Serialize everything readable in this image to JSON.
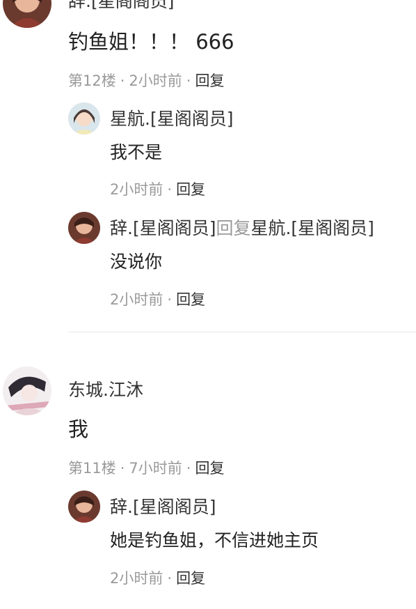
{
  "comments": [
    {
      "author": "辞.[星阁阁员]",
      "text": "钓鱼姐！！！ 666",
      "floor": "第12楼",
      "time": "2小时前",
      "reply_label": "回复",
      "replies": [
        {
          "author": "星航.[星阁阁员]",
          "text": "我不是",
          "time": "2小时前",
          "reply_label": "回复"
        },
        {
          "author": "辞.[星阁阁员]",
          "reply_word": "回复",
          "target": "星航.[星阁阁员]",
          "text": "没说你",
          "time": "2小时前",
          "reply_label": "回复"
        }
      ]
    },
    {
      "author": "东城.江沐",
      "text": "我",
      "floor": "第11楼",
      "time": "7小时前",
      "reply_label": "回复",
      "replies": [
        {
          "author": "辞.[星阁阁员]",
          "text": "她是钓鱼姐，不信进她主页",
          "time": "2小时前",
          "reply_label": "回复"
        }
      ]
    }
  ],
  "separator": "·"
}
